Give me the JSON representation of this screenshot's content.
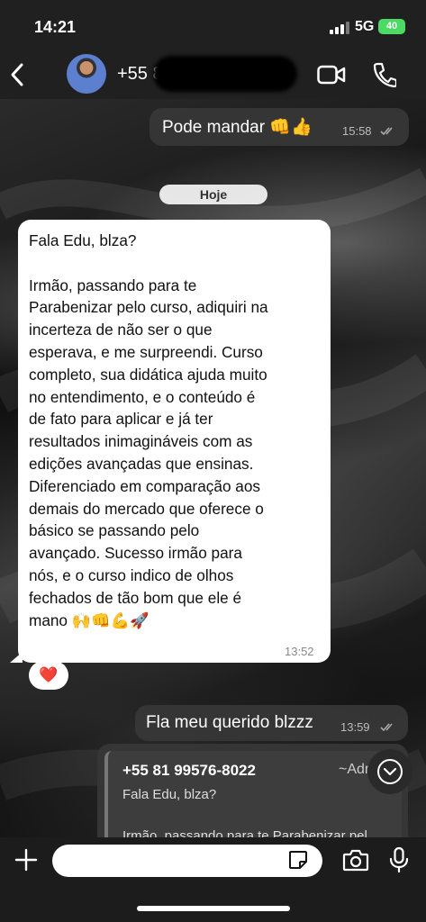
{
  "status_bar": {
    "time": "14:21",
    "network": "5G",
    "battery": "40"
  },
  "header": {
    "contact_name": "+55 8",
    "icons": {
      "back": "chevron-left-icon",
      "video": "video-camera-icon",
      "call": "phone-icon"
    }
  },
  "messages": [
    {
      "direction": "outgoing",
      "text": "Pode mandar 👊👍",
      "time": "15:58",
      "status": "read-double-check"
    },
    {
      "direction": "incoming",
      "text": "Fala Edu, blza?\n\nIrmão, passando para te\nParabenizar pelo curso, adiquiri na\nincerteza de não ser o que\nesperava, e me surpreendi. Curso\ncompleto, sua didática ajuda muito\nno entendimento, e o conteúdo é\nde fato para aplicar e já ter\nresultados inimagináveis com as\nedições avançadas que ensinas.\nDiferenciado em comparação aos\ndemais do mercado que oferece o\nbásico se passando pelo\navançado. Sucesso irmão para\nnós, e o curso indico de olhos\nfechados de tão bom que ele é\nmano 🙌👊💪🚀",
      "time": "13:52",
      "reaction": "❤️"
    },
    {
      "direction": "outgoing",
      "text": "Fla meu querido blzzz",
      "time": "13:59",
      "status": "read-double-check"
    }
  ],
  "date_divider": "Hoje",
  "reply_preview": {
    "number": "+55 81 99576-8022",
    "more": "~Adr",
    "line1": "Fala Edu, blza?",
    "line2": "Irmão, passando para te Parabenizar pel..."
  },
  "input_bar": {
    "placeholder": "",
    "icons": {
      "plus": "plus-icon",
      "sticker": "sticker-icon",
      "camera": "camera-icon",
      "mic": "microphone-icon"
    }
  },
  "colors": {
    "header_bg": "#202020",
    "outgoing_bubble": "#373737",
    "incoming_bubble": "#ffffff",
    "battery": "#4cd964",
    "reaction_heart": "#e0242e"
  }
}
